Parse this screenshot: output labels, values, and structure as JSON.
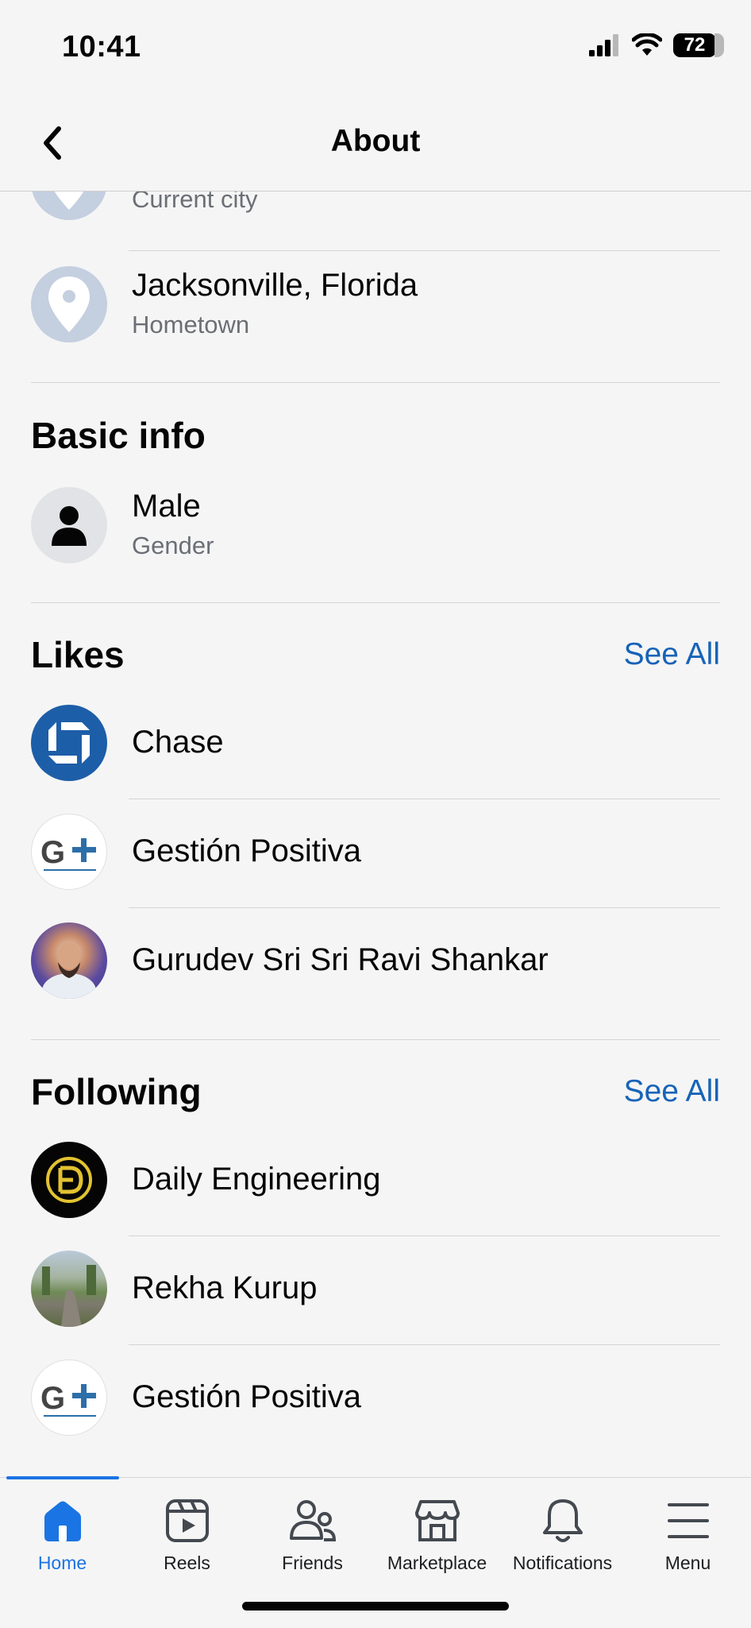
{
  "status_bar": {
    "time": "10:41",
    "battery": "72"
  },
  "header": {
    "title": "About",
    "back_icon": "chevron-left-icon"
  },
  "places": [
    {
      "primary": "",
      "secondary": "Current city",
      "icon": "location-pin-icon"
    },
    {
      "primary": "Jacksonville, Florida",
      "secondary": "Hometown",
      "icon": "location-pin-icon"
    }
  ],
  "basic_info": {
    "title": "Basic info",
    "items": [
      {
        "primary": "Male",
        "secondary": "Gender",
        "icon": "person-icon"
      }
    ]
  },
  "likes": {
    "title": "Likes",
    "see_all": "See All",
    "items": [
      {
        "name": "Chase",
        "avatar": "chase-logo"
      },
      {
        "name": "Gestión Positiva",
        "avatar": "gestion-positiva-logo"
      },
      {
        "name": "Gurudev Sri Sri Ravi Shankar",
        "avatar": "profile-photo"
      }
    ]
  },
  "following": {
    "title": "Following",
    "see_all": "See All",
    "items": [
      {
        "name": "Daily Engineering",
        "avatar": "daily-engineering-logo"
      },
      {
        "name": "Rekha Kurup",
        "avatar": "profile-photo"
      },
      {
        "name": "Gestión Positiva",
        "avatar": "gestion-positiva-logo"
      }
    ]
  },
  "tab_bar": {
    "active": "Home",
    "tabs": [
      {
        "label": "Home",
        "icon": "home-icon"
      },
      {
        "label": "Reels",
        "icon": "reels-icon"
      },
      {
        "label": "Friends",
        "icon": "friends-icon"
      },
      {
        "label": "Marketplace",
        "icon": "marketplace-icon"
      },
      {
        "label": "Notifications",
        "icon": "bell-icon"
      },
      {
        "label": "Menu",
        "icon": "hamburger-menu-icon"
      }
    ]
  },
  "colors": {
    "accent": "#1b74e4",
    "link": "#1763b8",
    "chase_blue": "#1d5ea8",
    "pin_bg": "#c4cfe0"
  }
}
